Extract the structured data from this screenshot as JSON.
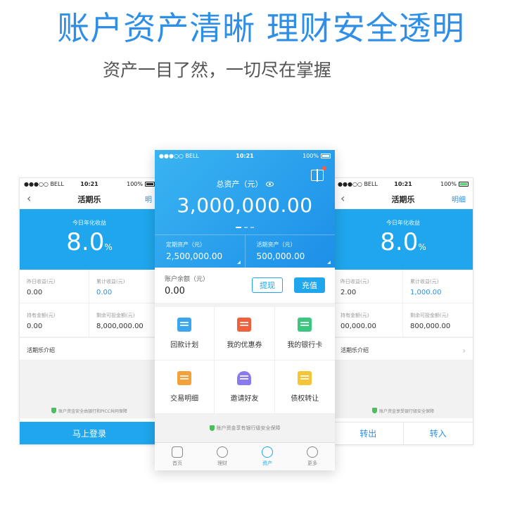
{
  "hero": {
    "headline": "账户资产清晰  理财安全透明",
    "subline": "资产一目了然，一切尽在掌握"
  },
  "status_side": {
    "carrier": "●●●○○ BELL",
    "time": "10:21",
    "battery": "100%"
  },
  "status_center": {
    "carrier": "●●●○○ BELL",
    "time": "10:21",
    "battery": "100%"
  },
  "left_phone": {
    "title": "活期乐",
    "link": "明",
    "rate_label": "今日年化收益",
    "rate_value": "8.0",
    "rate_unit": "%",
    "cells": [
      {
        "k": "昨日收益(元)",
        "v": "0.00"
      },
      {
        "k": "累计收益(元)",
        "v": "0.00"
      },
      {
        "k": "持有金额(元)",
        "v": "0.00"
      },
      {
        "k": "剩余可投金额(元)",
        "v": "8,000,000.00"
      }
    ],
    "intro": "活期乐介绍",
    "safe_note": "账户资金安全由银行和PICC共同保障",
    "action": "马上登录"
  },
  "right_phone": {
    "title": "活期乐",
    "link": "明细",
    "rate_label": "今日年化收益",
    "rate_value": "8.0",
    "rate_unit": "%",
    "cells": [
      {
        "k": "昨日收益(元)",
        "v": "2.00"
      },
      {
        "k": "累计收益(元)",
        "v": "1,000.00"
      },
      {
        "k": "持有金额(元)",
        "v": "00,000.00"
      },
      {
        "k": "剩余可投金额(元)",
        "v": "800,000.00"
      }
    ],
    "intro": "活期乐介绍",
    "safe_note": "账户资金享受银行级安全保障",
    "action_left": "转出",
    "action_right": "转入"
  },
  "center_phone": {
    "total_label": "总资产（元）",
    "total_value": "3,000,000.00",
    "fixed_label": "定期资产（元）",
    "fixed_value": "2,500,000.00",
    "current_label": "活期资产（元）",
    "current_value": "500,000.00",
    "balance_label": "账户余额（元）",
    "balance_value": "0.00",
    "withdraw": "提现",
    "recharge": "充值",
    "menu": [
      {
        "label": "回款计划",
        "icon": "calendar-icon",
        "color": "blue"
      },
      {
        "label": "我的优惠券",
        "icon": "coupon-icon",
        "color": "red"
      },
      {
        "label": "我的银行卡",
        "icon": "bank-card-icon",
        "color": "green"
      },
      {
        "label": "交易明细",
        "icon": "clipboard-icon",
        "color": "orange"
      },
      {
        "label": "邀请好友",
        "icon": "add-friend-icon",
        "color": "purple"
      },
      {
        "label": "债权转让",
        "icon": "transfer-icon",
        "color": "yellow"
      }
    ],
    "safe_note": "账户资金享有银行级安全保障",
    "tabs": [
      {
        "label": "首页",
        "icon": "home-icon"
      },
      {
        "label": "理财",
        "icon": "trend-icon"
      },
      {
        "label": "资产",
        "icon": "assets-icon",
        "active": true
      },
      {
        "label": "更多",
        "icon": "more-icon"
      }
    ]
  },
  "colors": {
    "accent": "#1fa6ec",
    "headline": "#2f8fe6",
    "safe": "#4bbf5b"
  }
}
